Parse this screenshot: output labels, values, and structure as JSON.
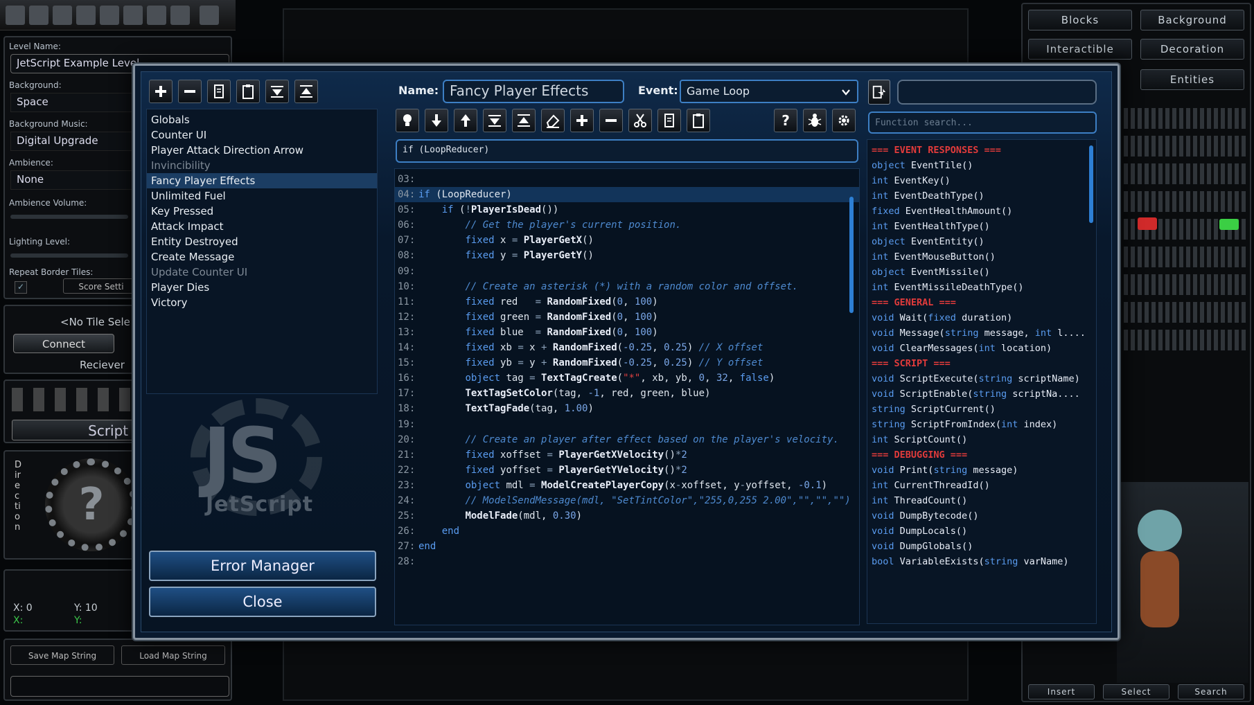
{
  "left_panel": {
    "level_name_label": "Level Name:",
    "level_name": "JetScript Example Level",
    "background_label": "Background:",
    "background": "Space",
    "music_label": "Background Music:",
    "music": "Digital Upgrade",
    "ambience_label": "Ambience:",
    "ambience": "None",
    "ambience_volume_label": "Ambience Volume:",
    "lighting_label": "Lighting Level:",
    "repeat_label": "Repeat Border Tiles:",
    "score_btn": "Score Setti",
    "no_tile": "<No Tile Sele",
    "connect": "Connect",
    "receivers": "Reciever",
    "script_editor": "Script Ed",
    "direction": "Direction",
    "x_label": "X: 0",
    "y_label": "Y: 10",
    "x2_label": "X:",
    "y2_label": "Y:",
    "save_map": "Save Map String",
    "load_map": "Load Map String"
  },
  "right_panel": {
    "tabs": [
      "Blocks",
      "Background",
      "Interactible",
      "Decoration",
      "Entities"
    ],
    "bottom_buttons": [
      "Insert",
      "Select",
      "Search"
    ]
  },
  "dialog": {
    "name_label": "Name:",
    "name_value": "Fancy Player Effects",
    "event_label": "Event:",
    "event_value": "Game Loop",
    "condition": "if (LoopReducer)",
    "function_search_placeholder": "Function search...",
    "error_manager": "Error Manager",
    "close": "Close",
    "logo_text": "JetScript",
    "logo_letters": "JS",
    "scripts": [
      {
        "name": "Globals",
        "disabled": false,
        "selected": false
      },
      {
        "name": "Counter UI",
        "disabled": false,
        "selected": false
      },
      {
        "name": "Player Attack Direction Arrow",
        "disabled": false,
        "selected": false
      },
      {
        "name": "Invincibility",
        "disabled": true,
        "selected": false
      },
      {
        "name": "Fancy Player Effects",
        "disabled": false,
        "selected": true
      },
      {
        "name": "Unlimited Fuel",
        "disabled": false,
        "selected": false
      },
      {
        "name": "Key Pressed",
        "disabled": false,
        "selected": false
      },
      {
        "name": "Attack Impact",
        "disabled": false,
        "selected": false
      },
      {
        "name": "Entity Destroyed",
        "disabled": false,
        "selected": false
      },
      {
        "name": "Create Message",
        "disabled": false,
        "selected": false
      },
      {
        "name": "Update Counter UI",
        "disabled": true,
        "selected": false
      },
      {
        "name": "Player Dies",
        "disabled": false,
        "selected": false
      },
      {
        "name": "Victory",
        "disabled": false,
        "selected": false
      }
    ],
    "code_lines": [
      {
        "n": "03:",
        "html": ""
      },
      {
        "n": "04:",
        "html": "<span class=\"kw\">if</span> (LoopReducer)",
        "current": true
      },
      {
        "n": "05:",
        "html": "    <span class=\"kw\">if</span> (<span class=\"op\">!</span><span class=\"fn\">PlayerIsDead</span>())"
      },
      {
        "n": "06:",
        "html": "        <span class=\"cm\">// Get the player's current position.</span>"
      },
      {
        "n": "07:",
        "html": "        <span class=\"kw\">fixed</span> x <span class=\"op\">=</span> <span class=\"fn\">PlayerGetX</span>()"
      },
      {
        "n": "08:",
        "html": "        <span class=\"kw\">fixed</span> y <span class=\"op\">=</span> <span class=\"fn\">PlayerGetY</span>()"
      },
      {
        "n": "09:",
        "html": ""
      },
      {
        "n": "10:",
        "html": "        <span class=\"cm\">// Create an asterisk (*) with a random color and offset.</span>"
      },
      {
        "n": "11:",
        "html": "        <span class=\"kw\">fixed</span> red   <span class=\"op\">=</span> <span class=\"fn\">RandomFixed</span>(<span class=\"num\">0</span>, <span class=\"num\">100</span>)"
      },
      {
        "n": "12:",
        "html": "        <span class=\"kw\">fixed</span> green <span class=\"op\">=</span> <span class=\"fn\">RandomFixed</span>(<span class=\"num\">0</span>, <span class=\"num\">100</span>)"
      },
      {
        "n": "13:",
        "html": "        <span class=\"kw\">fixed</span> blue  <span class=\"op\">=</span> <span class=\"fn\">RandomFixed</span>(<span class=\"num\">0</span>, <span class=\"num\">100</span>)"
      },
      {
        "n": "14:",
        "html": "        <span class=\"kw\">fixed</span> xb <span class=\"op\">=</span> x <span class=\"op\">+</span> <span class=\"fn\">RandomFixed</span>(<span class=\"num\">-0.25</span>, <span class=\"num\">0.25</span>) <span class=\"cm\">// X offset</span>"
      },
      {
        "n": "15:",
        "html": "        <span class=\"kw\">fixed</span> yb <span class=\"op\">=</span> y <span class=\"op\">+</span> <span class=\"fn\">RandomFixed</span>(<span class=\"num\">-0.25</span>, <span class=\"num\">0.25</span>) <span class=\"cm\">// Y offset</span>"
      },
      {
        "n": "16:",
        "html": "        <span class=\"kw\">object</span> tag <span class=\"op\">=</span> <span class=\"fn\">TextTagCreate</span>(<span class=\"str\">\"*\"</span>, xb, yb, <span class=\"num\">0</span>, <span class=\"num\">32</span>, <span class=\"kw\">false</span>)"
      },
      {
        "n": "17:",
        "html": "        <span class=\"fn\">TextTagSetColor</span>(tag, <span class=\"num\">-1</span>, red, green, blue)"
      },
      {
        "n": "18:",
        "html": "        <span class=\"fn\">TextTagFade</span>(tag, <span class=\"num\">1.00</span>)"
      },
      {
        "n": "19:",
        "html": ""
      },
      {
        "n": "20:",
        "html": "        <span class=\"cm\">// Create an player after effect based on the player's velocity.</span>"
      },
      {
        "n": "21:",
        "html": "        <span class=\"kw\">fixed</span> xoffset <span class=\"op\">=</span> <span class=\"fn\">PlayerGetXVelocity</span>()<span class=\"op\">*</span><span class=\"num\">2</span>"
      },
      {
        "n": "22:",
        "html": "        <span class=\"kw\">fixed</span> yoffset <span class=\"op\">=</span> <span class=\"fn\">PlayerGetYVelocity</span>()<span class=\"op\">*</span><span class=\"num\">2</span>"
      },
      {
        "n": "23:",
        "html": "        <span class=\"kw\">object</span> mdl <span class=\"op\">=</span> <span class=\"fn\">ModelCreatePlayerCopy</span>(x<span class=\"op\">-</span>xoffset, y<span class=\"op\">-</span>yoffset, <span class=\"num\">-0.1</span>)"
      },
      {
        "n": "24:",
        "html": "        <span class=\"cm\">// ModelSendMessage(mdl, \"SetTintColor\",\"255,0,255 2.00\",\"\",\"\",\"\")</span>"
      },
      {
        "n": "25:",
        "html": "        <span class=\"fn\">ModelFade</span>(mdl, <span class=\"num\">0.30</span>)"
      },
      {
        "n": "26:",
        "html": "    <span class=\"kw\">end</span>"
      },
      {
        "n": "27:",
        "html": "<span class=\"kw\">end</span>"
      },
      {
        "n": "28:",
        "html": ""
      }
    ],
    "functions": [
      {
        "header": "=== EVENT RESPONSES ==="
      },
      {
        "type": "object",
        "sig": "EventTile()"
      },
      {
        "type": "int",
        "sig": "EventKey()"
      },
      {
        "type": "int",
        "sig": "EventDeathType()"
      },
      {
        "type": "fixed",
        "sig": "EventHealthAmount()"
      },
      {
        "type": "int",
        "sig": "EventHealthType()"
      },
      {
        "type": "object",
        "sig": "EventEntity()"
      },
      {
        "type": "int",
        "sig": "EventMouseButton()"
      },
      {
        "type": "object",
        "sig": "EventMissile()"
      },
      {
        "type": "int",
        "sig": "EventMissileDeathType()"
      },
      {
        "header": "=== GENERAL ==="
      },
      {
        "type": "void",
        "sig": "Wait(",
        "args": [
          [
            "fixed",
            " duration"
          ]
        ],
        "end": ")"
      },
      {
        "type": "void",
        "sig": "Message(",
        "args": [
          [
            "string",
            " message, "
          ],
          [
            "int",
            " l..."
          ]
        ],
        "end": "."
      },
      {
        "type": "void",
        "sig": "ClearMessages(",
        "args": [
          [
            "int",
            " location"
          ]
        ],
        "end": ")"
      },
      {
        "header": "=== SCRIPT ==="
      },
      {
        "type": "void",
        "sig": "ScriptExecute(",
        "args": [
          [
            "string",
            " scriptName"
          ]
        ],
        "end": ")"
      },
      {
        "type": "void",
        "sig": "ScriptEnable(",
        "args": [
          [
            "string",
            " scriptNa..."
          ]
        ],
        "end": "."
      },
      {
        "type": "string",
        "sig": "ScriptCurrent()"
      },
      {
        "type": "string",
        "sig": "ScriptFromIndex(",
        "args": [
          [
            "int",
            " index"
          ]
        ],
        "end": ")"
      },
      {
        "type": "int",
        "sig": "ScriptCount()"
      },
      {
        "header": "=== DEBUGGING ==="
      },
      {
        "type": "void",
        "sig": "Print(",
        "args": [
          [
            "string",
            " message"
          ]
        ],
        "end": ")"
      },
      {
        "type": "int",
        "sig": "CurrentThreadId()"
      },
      {
        "type": "int",
        "sig": "ThreadCount()"
      },
      {
        "type": "void",
        "sig": "DumpBytecode()"
      },
      {
        "type": "void",
        "sig": "DumpLocals()"
      },
      {
        "type": "void",
        "sig": "DumpGlobals()"
      },
      {
        "type": "bool",
        "sig": "VariableExists(",
        "args": [
          [
            "string",
            " varName"
          ]
        ],
        "end": ")"
      }
    ]
  }
}
